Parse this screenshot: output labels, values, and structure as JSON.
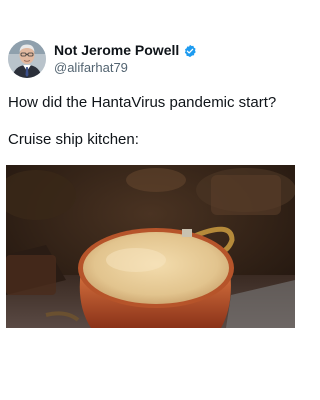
{
  "post": {
    "display_name": "Not Jerome Powell",
    "handle": "@alifarhat79",
    "text_line1": "How did the HantaVirus pandemic start?",
    "text_line2": "Cruise ship kitchen:"
  },
  "icons": {
    "verified": "verified-badge-icon",
    "avatar": "avatar"
  },
  "colors": {
    "verified_blue": "#1d9bf0",
    "handle_gray": "#536471",
    "text": "#0f1419",
    "pot_copper": "#c65a2e",
    "soup": "#e8cf9c"
  }
}
